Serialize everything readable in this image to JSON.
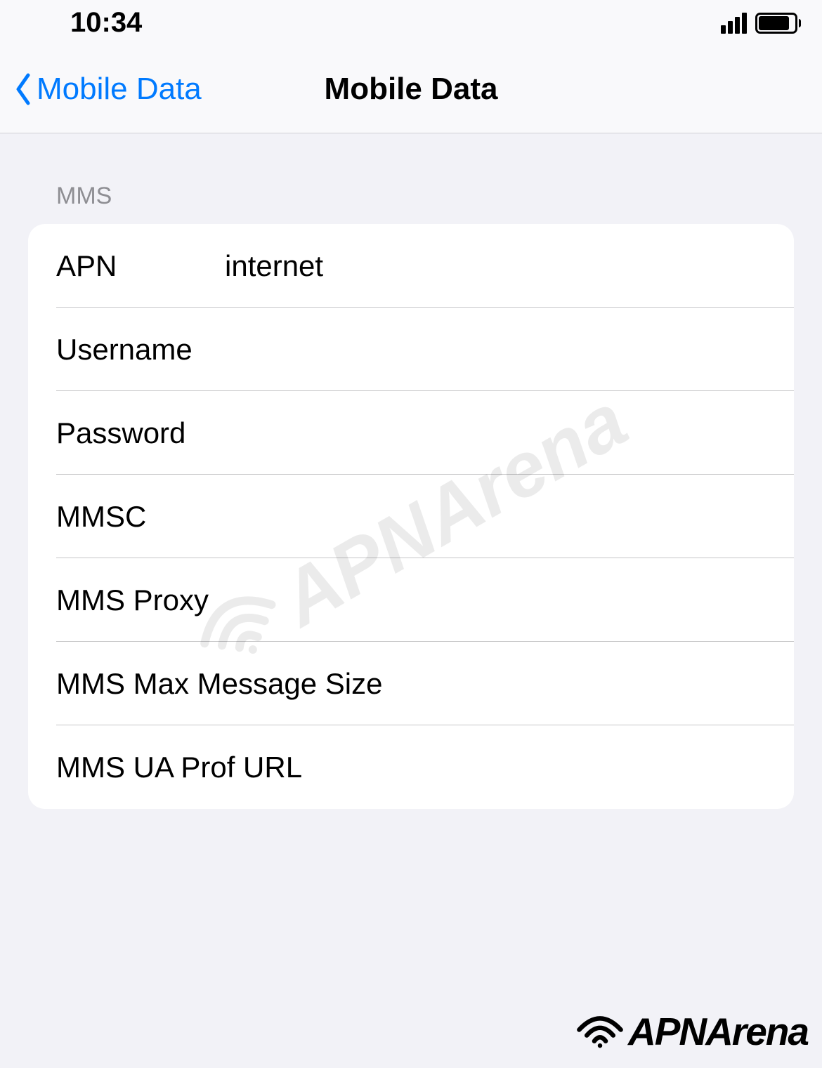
{
  "statusBar": {
    "time": "10:34"
  },
  "nav": {
    "backLabel": "Mobile Data",
    "title": "Mobile Data"
  },
  "section": {
    "header": "MMS",
    "rows": [
      {
        "label": "APN",
        "value": "internet",
        "wide": false
      },
      {
        "label": "Username",
        "value": "",
        "wide": false
      },
      {
        "label": "Password",
        "value": "",
        "wide": false
      },
      {
        "label": "MMSC",
        "value": "",
        "wide": false
      },
      {
        "label": "MMS Proxy",
        "value": "",
        "wide": true
      },
      {
        "label": "MMS Max Message Size",
        "value": "",
        "wide": true
      },
      {
        "label": "MMS UA Prof URL",
        "value": "",
        "wide": true
      }
    ]
  },
  "watermark": "APNArena",
  "footerBrand": "APNArena"
}
